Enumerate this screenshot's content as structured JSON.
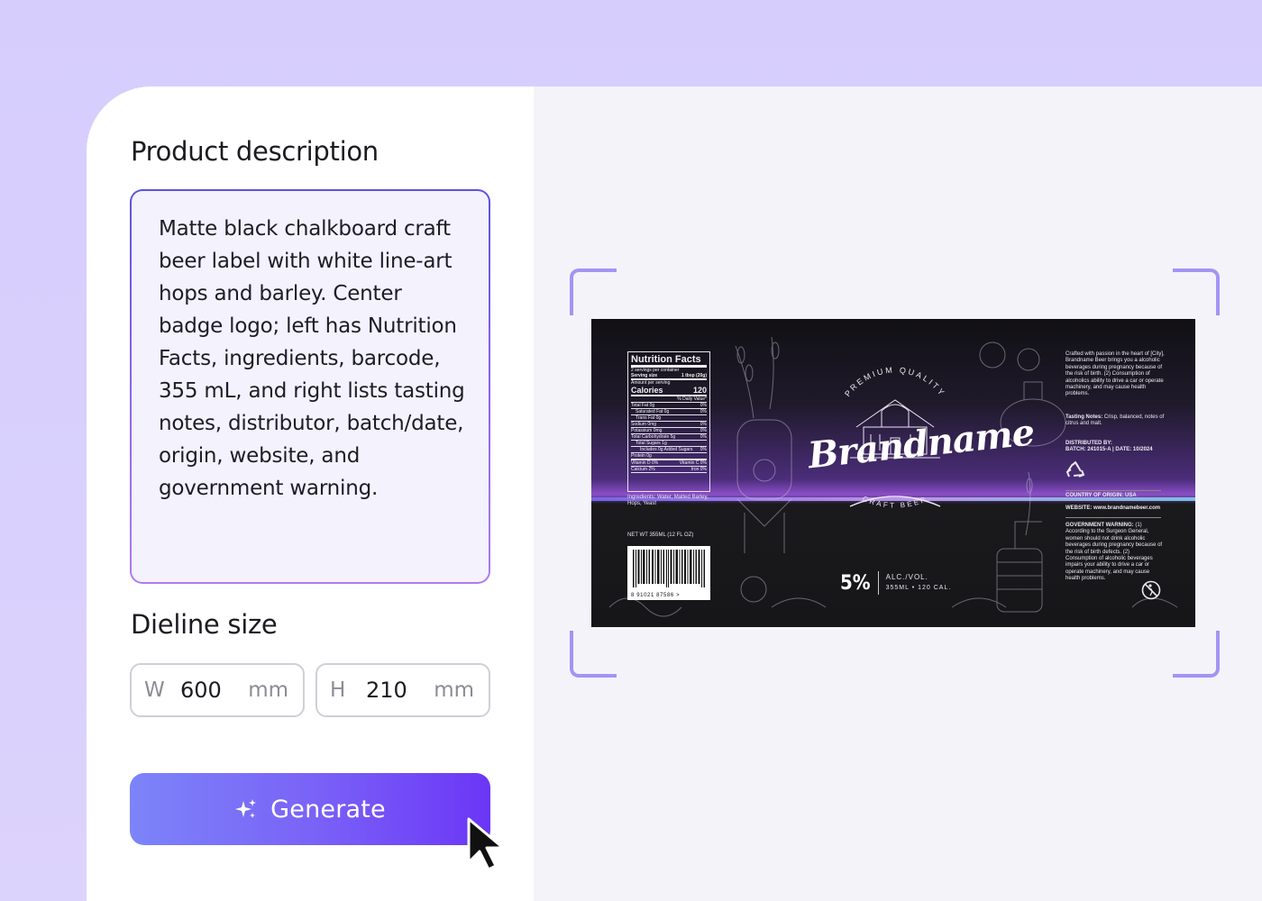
{
  "form": {
    "description_heading": "Product description",
    "description_text": "Matte black chalkboard craft beer label with white line-art hops and barley. Center badge logo; left has Nutrition Facts, ingredients, barcode, 355 mL, and right lists tasting notes, distributor, batch/date, origin, website, and government warning.",
    "dieline_heading": "Dieline size",
    "width": {
      "prefix": "W",
      "value": "600",
      "unit": "mm"
    },
    "height": {
      "prefix": "H",
      "value": "210",
      "unit": "mm"
    },
    "generate_label": "Generate"
  },
  "label": {
    "nutrition": {
      "title": "Nutrition Facts",
      "servings": "2 servings per container",
      "serving_size_label": "Serving size",
      "serving_size_value": "1 tbsp (20g)",
      "amount_per_serving": "Amount per serving",
      "calories_label": "Calories",
      "calories_value": "120",
      "daily_value": "% Daily Value*",
      "rows": [
        {
          "label": "Total Fat 0g",
          "value": "0%"
        },
        {
          "label": "Saturated Fat 0g",
          "value": "0%"
        },
        {
          "label": "Trans Fat 0g",
          "value": ""
        },
        {
          "label": "Sodium 0mg",
          "value": "0%"
        },
        {
          "label": "Potassium 0mg",
          "value": "0%"
        },
        {
          "label": "Total Carbohydrate 5g",
          "value": "0%"
        },
        {
          "label": "Total Sugars 1g",
          "value": ""
        },
        {
          "label": "Includes 0g Added Sugars",
          "value": "0%"
        },
        {
          "label": "Protein 0g",
          "value": ""
        }
      ],
      "vitamins": [
        {
          "label": "Vitamin D 0%",
          "value": "Vitamin C 0%"
        },
        {
          "label": "Calcium 2%",
          "value": "Iron 0%"
        }
      ]
    },
    "ingredients": "Ingredients: Water, Malted Barley, Hops, Yeast",
    "net_weight": "NET WT 355ML (12 FL OZ)",
    "barcode_number": "8  91021  87586  >",
    "badge_top": "PREMIUM QUALITY",
    "brand": "Brandname",
    "badge_bottom": "CRAFT BEER",
    "abv_value": "5%",
    "abv_label": "ALC./VOL.",
    "abv_sub": "355ML • 120 CAL.",
    "intro": "Crafted with passion in the heart of [City], Brandname Beer brings you a alcoholic beverages during pregnancy because of the risk of birth. (2) Consumption of alcoholics ability to drive a car or operate machinery, and may cause health problems.",
    "tasting_notes_label": "Tasting Notes:",
    "tasting_notes": "Crisp, balanced, notes of citrus and malt.",
    "distributed_by": "DISTRIBUTED BY:",
    "batch": "BATCH: 241015-A | DATE: 10/2024",
    "origin": "COUNTRY OF ORIGIN: USA",
    "website": "WEBSITE: www.brandnamebeer.com",
    "warning_label": "GOVERNMENT WARNING:",
    "warning_text": "(1) According to the Surgeon General, women should not drink alcoholic beverages during pregnancy because of the risk of birth defects. (2) Consumption of alcoholic beverages impairs your ability to drive a car or operate machinery, and may cause health problems."
  },
  "colors": {
    "accent": "#6b36f6",
    "accent_light": "#7c84f8",
    "frame": "#a593f5",
    "background": "#d6cdfd"
  }
}
